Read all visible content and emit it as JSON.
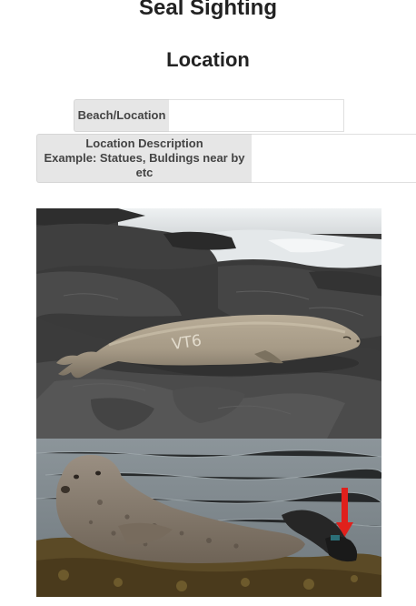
{
  "page": {
    "title": "Seal Sighting"
  },
  "location": {
    "heading": "Location",
    "beach": {
      "label": "Beach/Location",
      "value": "",
      "placeholder": ""
    },
    "description": {
      "label_line1": "Location Description",
      "label_line2": "Example: Statues, Buldings near by etc",
      "value": "",
      "placeholder": ""
    }
  },
  "photos": {
    "monk_seal": {
      "tag_text": "VT6"
    },
    "harbor_seal": {
      "arrow_color": "#e0201c"
    }
  }
}
